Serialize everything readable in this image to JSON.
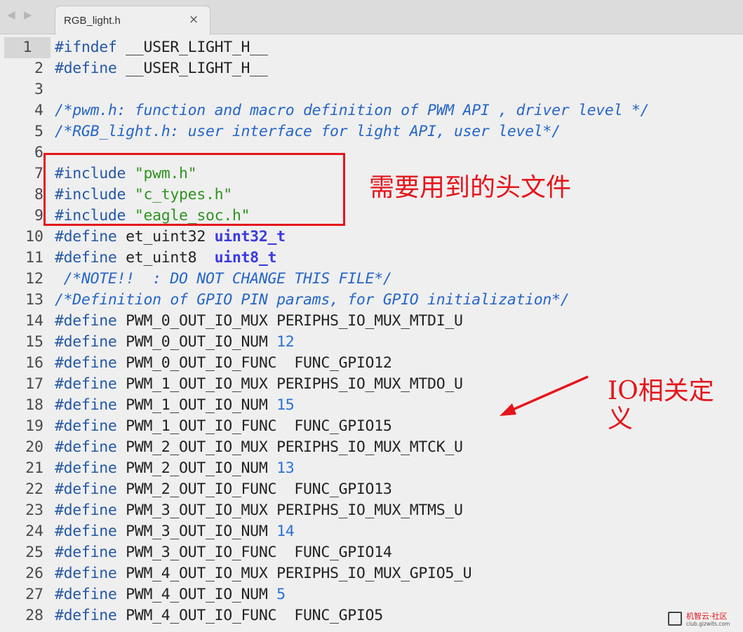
{
  "tab": {
    "title": "RGB_light.h",
    "close_glyph": "×",
    "back_glyph": "◀",
    "fwd_glyph": "▶"
  },
  "code_lines": [
    {
      "n": "1",
      "parts": [
        [
          "kw",
          "#ifndef"
        ],
        [
          "t",
          " __USER_LIGHT_H__"
        ]
      ]
    },
    {
      "n": "2",
      "parts": [
        [
          "kw",
          "#define"
        ],
        [
          "t",
          " __USER_LIGHT_H__"
        ]
      ]
    },
    {
      "n": "3",
      "parts": []
    },
    {
      "n": "4",
      "parts": [
        [
          "cmt",
          "/*pwm.h: function and macro definition of PWM API , driver level */"
        ]
      ]
    },
    {
      "n": "5",
      "parts": [
        [
          "cmt",
          "/*RGB_light.h: user interface for light API, user level*/"
        ]
      ]
    },
    {
      "n": "6",
      "parts": []
    },
    {
      "n": "7",
      "parts": [
        [
          "kw",
          "#include"
        ],
        [
          "t",
          " "
        ],
        [
          "str",
          "\"pwm.h\""
        ]
      ]
    },
    {
      "n": "8",
      "parts": [
        [
          "kw",
          "#include"
        ],
        [
          "t",
          " "
        ],
        [
          "str",
          "\"c_types.h\""
        ]
      ]
    },
    {
      "n": "9",
      "parts": [
        [
          "kw",
          "#include"
        ],
        [
          "t",
          " "
        ],
        [
          "str",
          "\"eagle_soc.h\""
        ]
      ]
    },
    {
      "n": "10",
      "parts": [
        [
          "kw",
          "#define"
        ],
        [
          "t",
          " et_uint32 "
        ],
        [
          "ty",
          "uint32_t"
        ]
      ]
    },
    {
      "n": "11",
      "parts": [
        [
          "kw",
          "#define"
        ],
        [
          "t",
          " et_uint8  "
        ],
        [
          "ty",
          "uint8_t"
        ]
      ]
    },
    {
      "n": "12",
      "parts": [
        [
          "t",
          " "
        ],
        [
          "cmt",
          "/*NOTE!!  : DO NOT CHANGE THIS FILE*/"
        ]
      ]
    },
    {
      "n": "13",
      "parts": [
        [
          "cmt",
          "/*Definition of GPIO PIN params, for GPIO initialization*/"
        ]
      ]
    },
    {
      "n": "14",
      "parts": [
        [
          "kw",
          "#define"
        ],
        [
          "t",
          " PWM_0_OUT_IO_MUX PERIPHS_IO_MUX_MTDI_U"
        ]
      ]
    },
    {
      "n": "15",
      "parts": [
        [
          "kw",
          "#define"
        ],
        [
          "t",
          " PWM_0_OUT_IO_NUM "
        ],
        [
          "num",
          "12"
        ]
      ]
    },
    {
      "n": "16",
      "parts": [
        [
          "kw",
          "#define"
        ],
        [
          "t",
          " PWM_0_OUT_IO_FUNC  FUNC_GPIO12"
        ]
      ]
    },
    {
      "n": "17",
      "parts": [
        [
          "kw",
          "#define"
        ],
        [
          "t",
          " PWM_1_OUT_IO_MUX PERIPHS_IO_MUX_MTDO_U"
        ]
      ]
    },
    {
      "n": "18",
      "parts": [
        [
          "kw",
          "#define"
        ],
        [
          "t",
          " PWM_1_OUT_IO_NUM "
        ],
        [
          "num",
          "15"
        ]
      ]
    },
    {
      "n": "19",
      "parts": [
        [
          "kw",
          "#define"
        ],
        [
          "t",
          " PWM_1_OUT_IO_FUNC  FUNC_GPIO15"
        ]
      ]
    },
    {
      "n": "20",
      "parts": [
        [
          "kw",
          "#define"
        ],
        [
          "t",
          " PWM_2_OUT_IO_MUX PERIPHS_IO_MUX_MTCK_U"
        ]
      ]
    },
    {
      "n": "21",
      "parts": [
        [
          "kw",
          "#define"
        ],
        [
          "t",
          " PWM_2_OUT_IO_NUM "
        ],
        [
          "num",
          "13"
        ]
      ]
    },
    {
      "n": "22",
      "parts": [
        [
          "kw",
          "#define"
        ],
        [
          "t",
          " PWM_2_OUT_IO_FUNC  FUNC_GPIO13"
        ]
      ]
    },
    {
      "n": "23",
      "parts": [
        [
          "kw",
          "#define"
        ],
        [
          "t",
          " PWM_3_OUT_IO_MUX PERIPHS_IO_MUX_MTMS_U"
        ]
      ]
    },
    {
      "n": "24",
      "parts": [
        [
          "kw",
          "#define"
        ],
        [
          "t",
          " PWM_3_OUT_IO_NUM "
        ],
        [
          "num",
          "14"
        ]
      ]
    },
    {
      "n": "25",
      "parts": [
        [
          "kw",
          "#define"
        ],
        [
          "t",
          " PWM_3_OUT_IO_FUNC  FUNC_GPIO14"
        ]
      ]
    },
    {
      "n": "26",
      "parts": [
        [
          "kw",
          "#define"
        ],
        [
          "t",
          " PWM_4_OUT_IO_MUX PERIPHS_IO_MUX_GPIO5_U"
        ]
      ]
    },
    {
      "n": "27",
      "parts": [
        [
          "kw",
          "#define"
        ],
        [
          "t",
          " PWM_4_OUT_IO_NUM "
        ],
        [
          "num",
          "5"
        ]
      ]
    },
    {
      "n": "28",
      "parts": [
        [
          "kw",
          "#define"
        ],
        [
          "t",
          " PWM_4_OUT_IO_FUNC  FUNC_GPIO5"
        ]
      ]
    }
  ],
  "annotations": {
    "header_note": "需要用到的头文件",
    "io_note_line1": "IO相关定",
    "io_note_line2": "义",
    "color": "#e4161c"
  },
  "watermark": {
    "name": "机智云·社区",
    "url": "club.gizwits.com"
  },
  "colors": {
    "keyword": "#2458a6",
    "string": "#2e9320",
    "comment": "#2666c8",
    "number": "#2a72d8",
    "type": "#3a3adf"
  }
}
